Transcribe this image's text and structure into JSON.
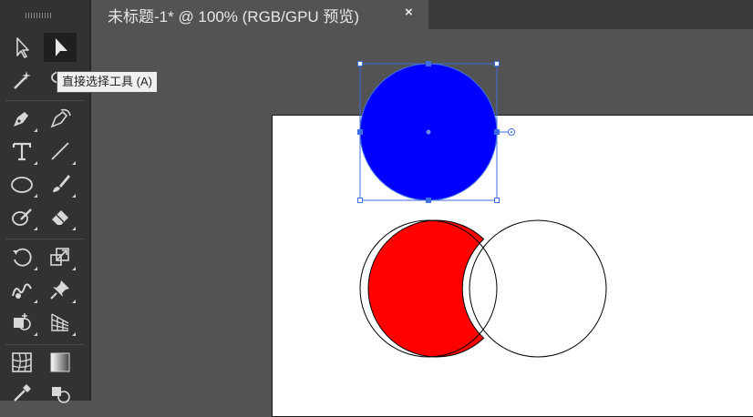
{
  "document": {
    "tab_title": "未标题-1* @ 100% (RGB/GPU 预览)",
    "close_glyph": "×"
  },
  "tooltip": {
    "text": "直接选择工具 (A)"
  },
  "tools": [
    {
      "name": "selection-tool",
      "icon": "arrow-outline-icon"
    },
    {
      "name": "direct-selection-tool",
      "icon": "arrow-filled-icon",
      "active": true
    },
    {
      "name": "magic-wand-tool",
      "icon": "magic-wand-icon"
    },
    {
      "name": "lasso-tool",
      "icon": "lasso-icon"
    },
    {
      "name": "pen-tool",
      "icon": "pen-icon"
    },
    {
      "name": "curvature-tool",
      "icon": "curvature-pen-icon"
    },
    {
      "name": "type-tool",
      "icon": "type-icon"
    },
    {
      "name": "line-segment-tool",
      "icon": "line-icon"
    },
    {
      "name": "ellipse-tool",
      "icon": "ellipse-icon"
    },
    {
      "name": "paintbrush-tool",
      "icon": "brush-icon"
    },
    {
      "name": "shaper-tool",
      "icon": "shaper-icon"
    },
    {
      "name": "eraser-tool",
      "icon": "eraser-icon"
    },
    {
      "name": "rotate-tool",
      "icon": "rotate-icon"
    },
    {
      "name": "scale-tool",
      "icon": "scale-icon"
    },
    {
      "name": "warp-tool",
      "icon": "warp-icon"
    },
    {
      "name": "puppet-warp-tool",
      "icon": "pin-icon"
    },
    {
      "name": "shape-builder-tool",
      "icon": "shape-builder-icon"
    },
    {
      "name": "perspective-grid-tool",
      "icon": "perspective-grid-icon"
    },
    {
      "name": "mesh-tool",
      "icon": "mesh-icon"
    },
    {
      "name": "gradient-tool",
      "icon": "gradient-icon"
    },
    {
      "name": "eyedropper-tool",
      "icon": "eyedropper-icon"
    },
    {
      "name": "blend-tool",
      "icon": "blend-icon"
    }
  ],
  "artwork": {
    "selected_circle_fill": "#0000ff",
    "selection_color": "#3d6ee0",
    "red_circle_fill": "#ff0000",
    "outline_color": "#000000",
    "artboard_color": "#ffffff"
  }
}
